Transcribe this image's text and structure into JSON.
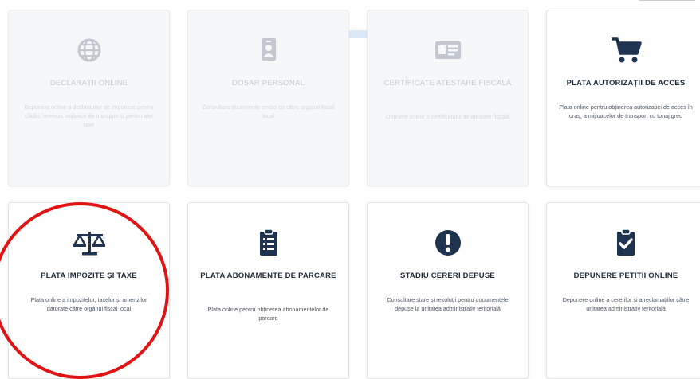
{
  "cards": [
    {
      "title": "DECLARAȚII ONLINE",
      "desc": "Depunere online a declarațiilor de impunere pentru clădiri, terenuri, mijloace de transport și pentru alte taxe",
      "icon": "globe-icon",
      "enabled": false
    },
    {
      "title": "DOSAR PERSONAL",
      "desc": "Consultare documente emise de către organul fiscal local",
      "icon": "id-badge-icon",
      "enabled": false
    },
    {
      "title": "CERTIFICATE ATESTARE FISCALĂ",
      "desc": "Obținere online a certificatului de atestare fiscală",
      "icon": "id-card-icon",
      "enabled": false
    },
    {
      "title": "PLATA AUTORIZAȚII DE ACCES",
      "desc": "Plata online pentru obținerea autorizației de acces în oraș, a mijloacelor de transport cu tonaj greu",
      "icon": "shopping-cart-icon",
      "enabled": true
    },
    {
      "title": "PLATA IMPOZITE ȘI TAXE",
      "desc": "Plata online a impozitelor, taxelor și amenzilor datorate către organul fiscal local",
      "icon": "balance-scale-icon",
      "enabled": true
    },
    {
      "title": "PLATA ABONAMENTE DE PARCARE",
      "desc": "Plata online pentru obținerea abonamentelor de parcare",
      "icon": "clipboard-list-icon",
      "enabled": true
    },
    {
      "title": "STADIU CERERI DEPUSE",
      "desc": "Consultare stare și rezoluții pentru documentele depuse la unitatea administrativ teritorială",
      "icon": "exclamation-circle-icon",
      "enabled": true
    },
    {
      "title": "DEPUNERE PETIȚII ONLINE",
      "desc": "Depunere online a cererilor și a reclamațiilor către unitatea administrativ teritorială",
      "icon": "clipboard-check-icon",
      "enabled": true
    }
  ],
  "colors": {
    "icon_active": "#1e3350",
    "icon_disabled": "#c3c8d0",
    "highlight_circle": "#e01414"
  }
}
